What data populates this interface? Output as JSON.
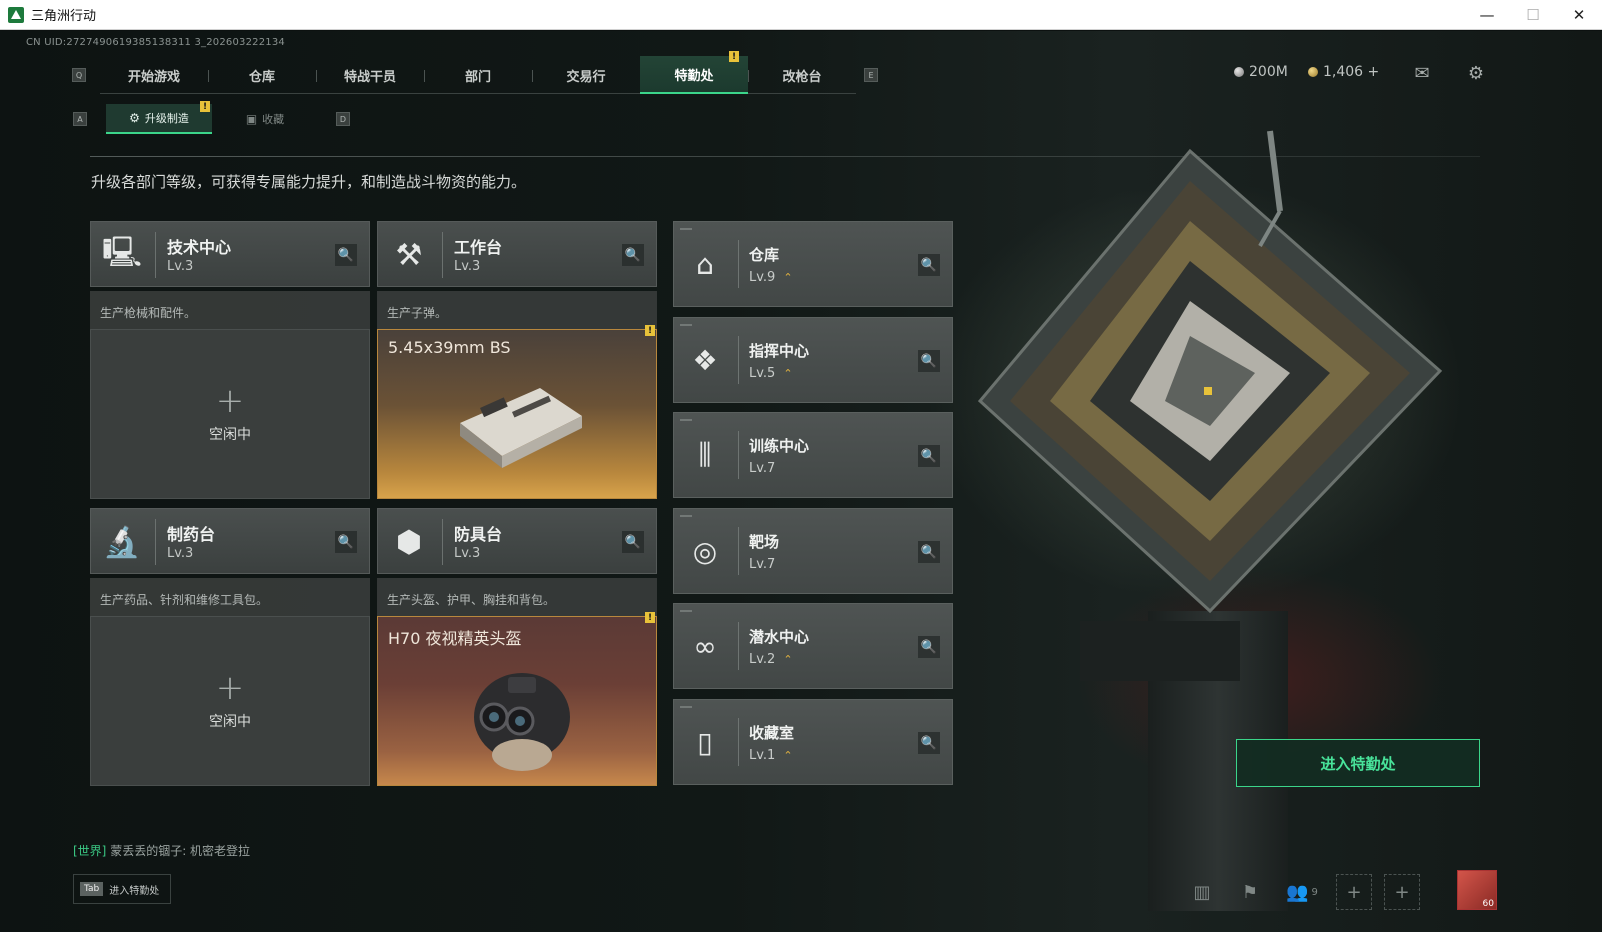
{
  "window": {
    "title": "三角洲行动",
    "controls": {
      "minimize": "—",
      "maximize": "☐",
      "close": "✕"
    }
  },
  "uid_text": "CN UID:2727490619385138311 3_202603222134",
  "nav": {
    "left_key": "Q",
    "right_key": "E",
    "items": [
      {
        "label": "开始游戏"
      },
      {
        "label": "仓库"
      },
      {
        "label": "特战干员"
      },
      {
        "label": "部门"
      },
      {
        "label": "交易行"
      },
      {
        "label": "特勤处",
        "active": true,
        "badge": "!"
      },
      {
        "label": "改枪台"
      }
    ]
  },
  "currency": {
    "silver": "200M",
    "gold": "1,406 +"
  },
  "top_icons": {
    "mail": "mail-icon",
    "settings": "gear-icon"
  },
  "subtabs": {
    "left_key": "A",
    "right_key": "D",
    "items": [
      {
        "label": "升级制造",
        "active": true,
        "badge": "!"
      },
      {
        "label": "收藏"
      }
    ]
  },
  "description": "升级各部门等级，可获得专属能力提升，和制造战斗物资的能力。",
  "workstations": [
    {
      "name": "技术中心",
      "level": "Lv.3",
      "desc": "生产枪械和配件。",
      "status": "idle",
      "idle_label": "空闲中",
      "icon": "computer-icon"
    },
    {
      "name": "工作台",
      "level": "Lv.3",
      "desc": "生产子弹。",
      "status": "producing",
      "product": "5.45x39mm BS",
      "badge": "!",
      "icon": "hammer-wrench-icon"
    },
    {
      "name": "制药台",
      "level": "Lv.3",
      "desc": "生产药品、针剂和维修工具包。",
      "status": "idle",
      "idle_label": "空闲中",
      "icon": "microscope-icon"
    },
    {
      "name": "防具台",
      "level": "Lv.3",
      "desc": "生产头盔、护甲、胸挂和背包。",
      "status": "producing",
      "product": "H70 夜视精英头盔",
      "badge": "!",
      "icon": "boxes-icon"
    }
  ],
  "departments": [
    {
      "name": "仓库",
      "level": "Lv.9",
      "upgradable": true,
      "icon": "warehouse-icon"
    },
    {
      "name": "指挥中心",
      "level": "Lv.5",
      "upgradable": true,
      "icon": "command-icon"
    },
    {
      "name": "训练中心",
      "level": "Lv.7",
      "upgradable": false,
      "icon": "dumbbell-icon"
    },
    {
      "name": "靶场",
      "level": "Lv.7",
      "upgradable": false,
      "icon": "target-icon"
    },
    {
      "name": "潜水中心",
      "level": "Lv.2",
      "upgradable": true,
      "icon": "diving-mask-icon"
    },
    {
      "name": "收藏室",
      "level": "Lv.1",
      "upgradable": true,
      "icon": "collection-icon"
    }
  ],
  "upgrade_glyph": "⌃",
  "enter_button": "进入特勤处",
  "chat": {
    "channel": "[世界]",
    "message": "蒙丢丢的锢子: 机密老登拉"
  },
  "tab_hint": {
    "key": "Tab",
    "label": "进入特勤处"
  },
  "party_count": "9",
  "avatar_level": "60",
  "colors": {
    "accent": "#3bd58a",
    "badge": "#e8c23a",
    "upgrade": "#e0b240"
  }
}
